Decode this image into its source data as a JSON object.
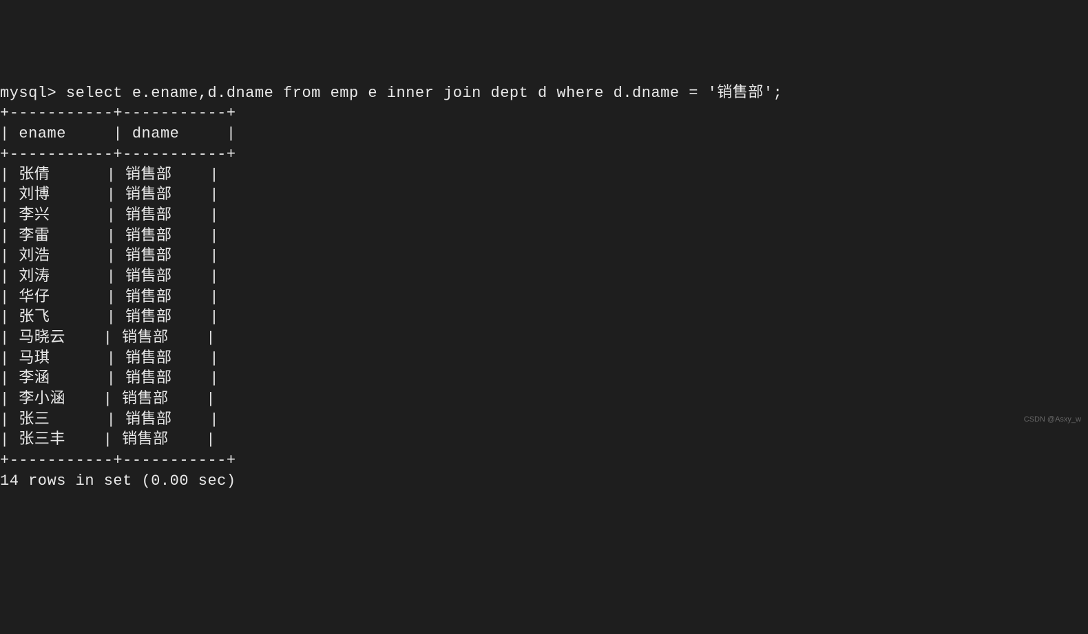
{
  "prompt": "mysql> ",
  "query": "select e.ename,d.dname from emp e inner join dept d where d.dname = '销售部';",
  "columns": [
    "ename",
    "dname"
  ],
  "rows": [
    {
      "ename": "张倩",
      "dname": "销售部"
    },
    {
      "ename": "刘博",
      "dname": "销售部"
    },
    {
      "ename": "李兴",
      "dname": "销售部"
    },
    {
      "ename": "李雷",
      "dname": "销售部"
    },
    {
      "ename": "刘浩",
      "dname": "销售部"
    },
    {
      "ename": "刘涛",
      "dname": "销售部"
    },
    {
      "ename": "华仔",
      "dname": "销售部"
    },
    {
      "ename": "张飞",
      "dname": "销售部"
    },
    {
      "ename": "马晓云",
      "dname": "销售部"
    },
    {
      "ename": "马琪",
      "dname": "销售部"
    },
    {
      "ename": "李涵",
      "dname": "销售部"
    },
    {
      "ename": "李小涵",
      "dname": "销售部"
    },
    {
      "ename": "张三",
      "dname": "销售部"
    },
    {
      "ename": "张三丰",
      "dname": "销售部"
    }
  ],
  "separator": "+-----------+-----------+",
  "footer": "14 rows in set (0.00 sec)",
  "watermark": "CSDN @Asxy_w"
}
